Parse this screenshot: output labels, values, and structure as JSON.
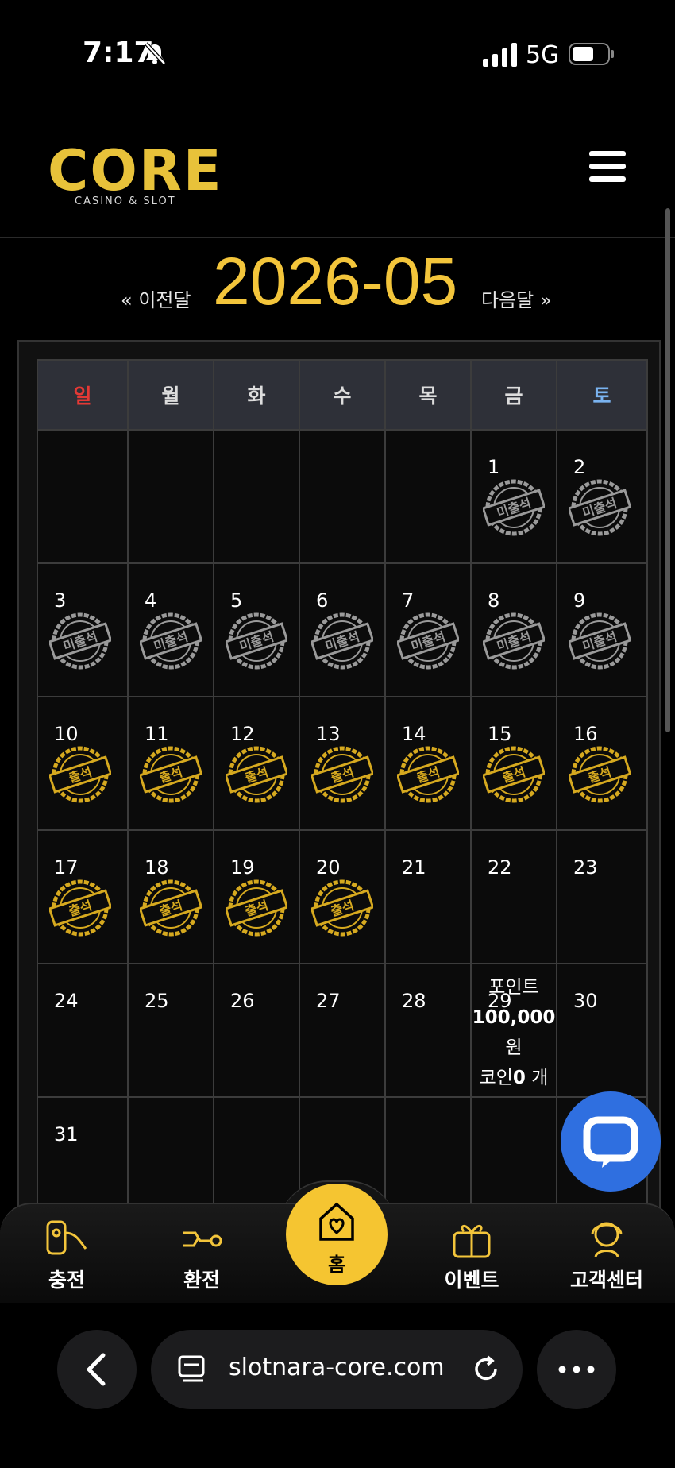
{
  "status": {
    "time": "7:17",
    "network": "5G"
  },
  "brand": {
    "logo_main": "CORE",
    "logo_sub": "CASINO & SLOT"
  },
  "month_nav": {
    "prev": "« 이전달",
    "title": "2026-05",
    "next": "다음달 »"
  },
  "calendar": {
    "weekdays": [
      "일",
      "월",
      "화",
      "수",
      "목",
      "금",
      "토"
    ],
    "weeks": [
      [
        "",
        "",
        "",
        "",
        "",
        "1",
        "2"
      ],
      [
        "3",
        "4",
        "5",
        "6",
        "7",
        "8",
        "9"
      ],
      [
        "10",
        "11",
        "12",
        "13",
        "14",
        "15",
        "16"
      ],
      [
        "17",
        "18",
        "19",
        "20",
        "21",
        "22",
        "23"
      ],
      [
        "24",
        "25",
        "26",
        "27",
        "28",
        "29",
        "30"
      ],
      [
        "31",
        "",
        "",
        "",
        "",
        "",
        ""
      ]
    ],
    "absent_stamp": "미출석",
    "present_stamp": "출석",
    "absent_days": [
      1,
      2,
      3,
      4,
      5,
      6,
      7,
      8,
      9
    ],
    "present_days": [
      10,
      11,
      12,
      13,
      14,
      15,
      16,
      17,
      18,
      19,
      20
    ],
    "point_info": {
      "line1": "포인트",
      "amount": "100,000",
      "unit": "원",
      "coin_prefix": "코인",
      "coin_value": "0",
      "coin_unit": "개"
    }
  },
  "bottom_nav": [
    {
      "label": "충전",
      "icon": "deposit-icon"
    },
    {
      "label": "환전",
      "icon": "withdraw-icon"
    },
    {
      "label": "홈",
      "icon": "home-heart-icon"
    },
    {
      "label": "이벤트",
      "icon": "gift-icon"
    },
    {
      "label": "고객센터",
      "icon": "support-icon"
    }
  ],
  "browser": {
    "url": "slotnara-core.com"
  },
  "colors": {
    "accent": "#f3c53b",
    "sunday": "#e53935",
    "saturday": "#7ab3f0",
    "chat": "#2f6fe0"
  }
}
